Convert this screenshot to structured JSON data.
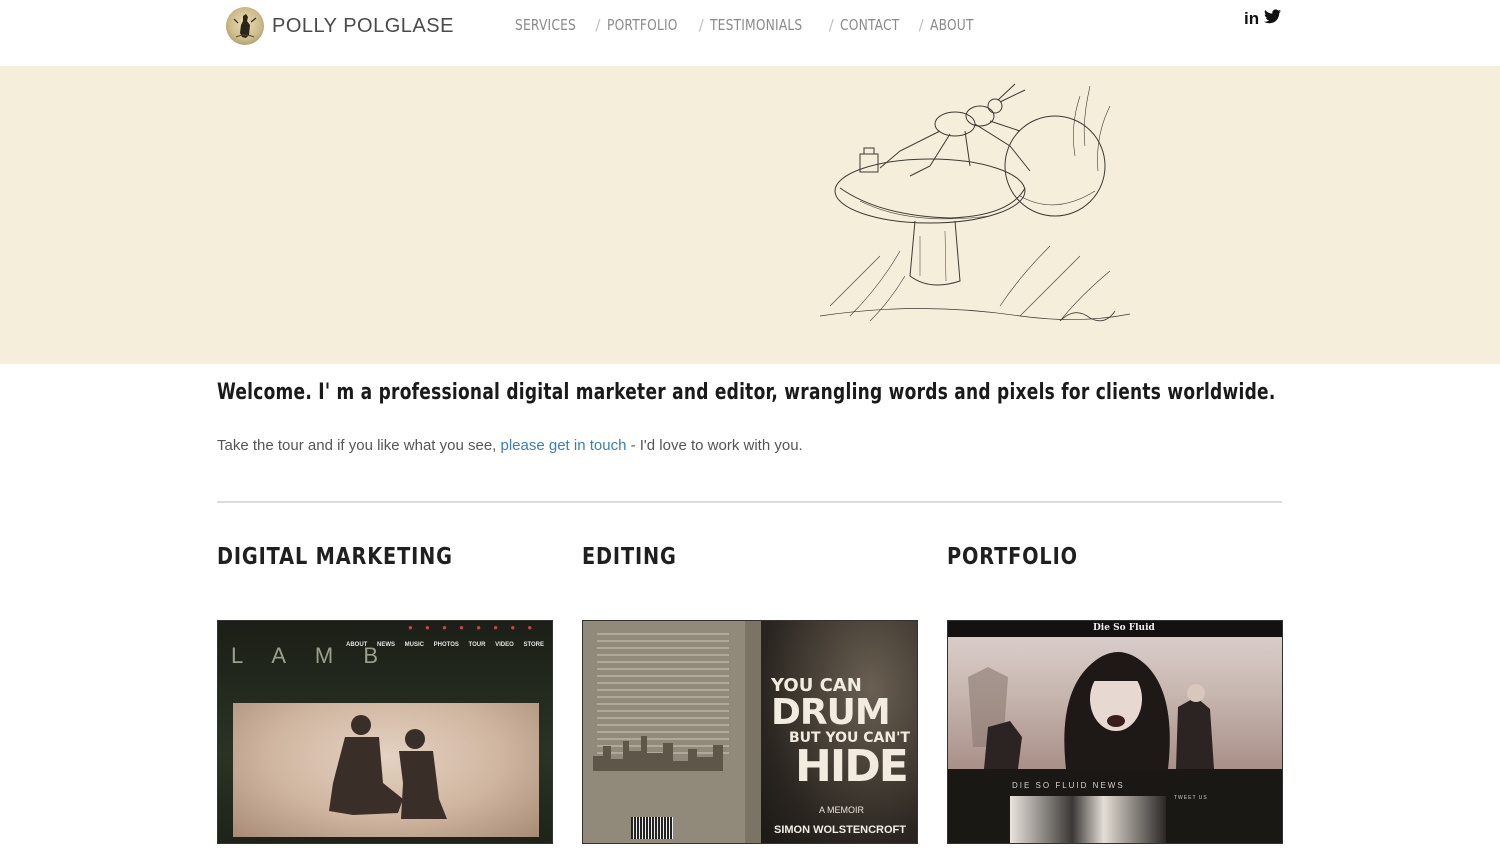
{
  "header": {
    "logo_name": "POLLY POLGLASE",
    "nav": [
      {
        "label": "SERVICES"
      },
      {
        "label": "PORTFOLIO"
      },
      {
        "label": "TESTIMONIALS"
      },
      {
        "label": "CONTACT"
      },
      {
        "label": "ABOUT"
      }
    ],
    "separator": "/",
    "social": [
      {
        "icon": "linkedin-icon",
        "label": "in"
      },
      {
        "icon": "twitter-icon",
        "label": "🐦"
      }
    ]
  },
  "intro": {
    "heading": "Welcome. I' m a professional digital marketer and editor, wrangling words and pixels for clients worldwide.",
    "text_before": "Take the tour and if you like what you see, ",
    "link_text": "please get in touch",
    "text_after": " - I'd love to work with you."
  },
  "sections": [
    {
      "title": "DIGITAL MARKETING"
    },
    {
      "title": "EDITING"
    },
    {
      "title": "PORTFOLIO"
    }
  ],
  "cards": {
    "lamb": {
      "logo": "L A M B",
      "nav": "ABOUT NEWS MUSIC PHOTOS TOUR VIDEO STORE"
    },
    "book": {
      "title_line1": "YOU CAN",
      "title_line2": "DRUM",
      "title_line3": "BUT YOU CAN'T",
      "title_line4": "HIDE",
      "memoir": "A MEMOIR",
      "author": "SIMON WOLSTENCROFT"
    },
    "dsf": {
      "brand": "Die So Fluid",
      "news": "DIE SO FLUID NEWS",
      "tweet": "TWEET US"
    }
  },
  "colors": {
    "hero_bg": "#f5eedb",
    "link": "#3a7fb5",
    "nav_text": "#8a8a8a"
  }
}
